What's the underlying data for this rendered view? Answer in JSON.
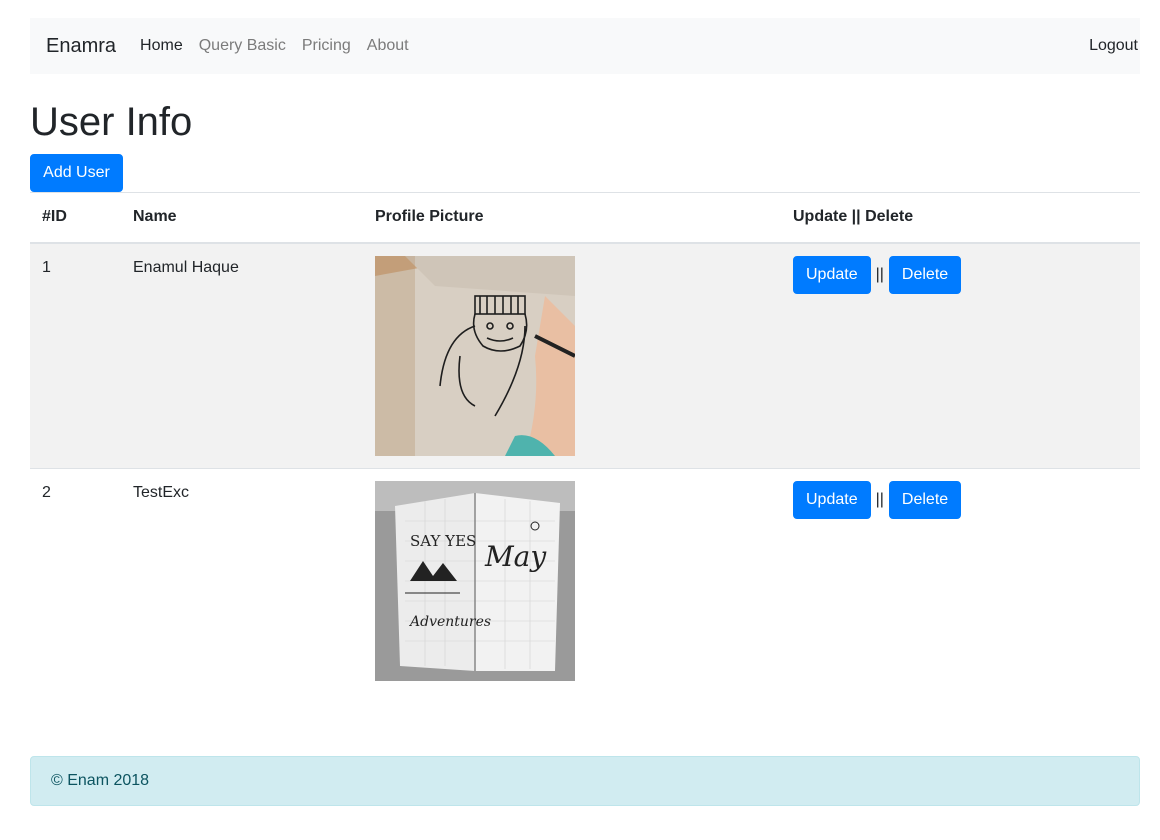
{
  "navbar": {
    "brand": "Enamra",
    "links": [
      {
        "label": "Home",
        "active": true
      },
      {
        "label": "Query Basic",
        "active": false
      },
      {
        "label": "Pricing",
        "active": false
      },
      {
        "label": "About",
        "active": false
      }
    ],
    "logout": "Logout"
  },
  "page": {
    "title": "User Info",
    "add_button": "Add User"
  },
  "table": {
    "headers": [
      "#ID",
      "Name",
      "Profile Picture",
      "Update || Delete"
    ],
    "rows": [
      {
        "id": "1",
        "name": "Enamul Haque",
        "picture": "sketch-drawing-photo",
        "update": "Update",
        "separator": "||",
        "delete": "Delete"
      },
      {
        "id": "2",
        "name": "TestExc",
        "picture": "notebook-say-yes-photo",
        "update": "Update",
        "separator": "||",
        "delete": "Delete"
      }
    ]
  },
  "footer": {
    "text": "© Enam 2018"
  },
  "colors": {
    "primary": "#007bff",
    "navbar_bg": "#f8f9fa",
    "footer_bg": "#d1ecf1",
    "footer_text": "#0c5460",
    "stripe": "#f2f2f2"
  }
}
